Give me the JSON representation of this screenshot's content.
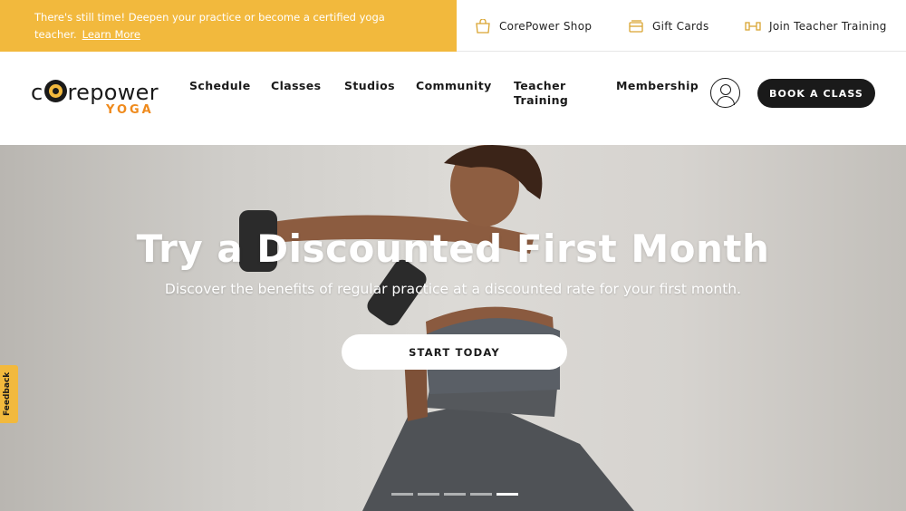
{
  "promo": {
    "message": "There's still time! Deepen your practice or become a certified yoga teacher.",
    "link": "Learn More"
  },
  "utility": {
    "shop": "CorePower Shop",
    "gift": "Gift Cards",
    "teacher": "Join Teacher Training"
  },
  "logo": {
    "word_pre": "c",
    "word_post": "repower",
    "sub": "YOGA"
  },
  "nav": {
    "schedule": "Schedule",
    "classes": "Classes",
    "studios": "Studios",
    "community": "Community",
    "teacher_training": "Teacher Training",
    "membership": "Membership",
    "book": "BOOK A CLASS"
  },
  "hero": {
    "headline": "Try a Discounted First Month",
    "subline": "Discover the benefits of regular practice at a discounted rate for your first month.",
    "cta": "START TODAY",
    "slides": 5,
    "active_slide": 5
  },
  "feedback": "Feedback",
  "colors": {
    "accent": "#f2b93d",
    "orange": "#ef8a1c",
    "dark": "#1a1a1a"
  }
}
